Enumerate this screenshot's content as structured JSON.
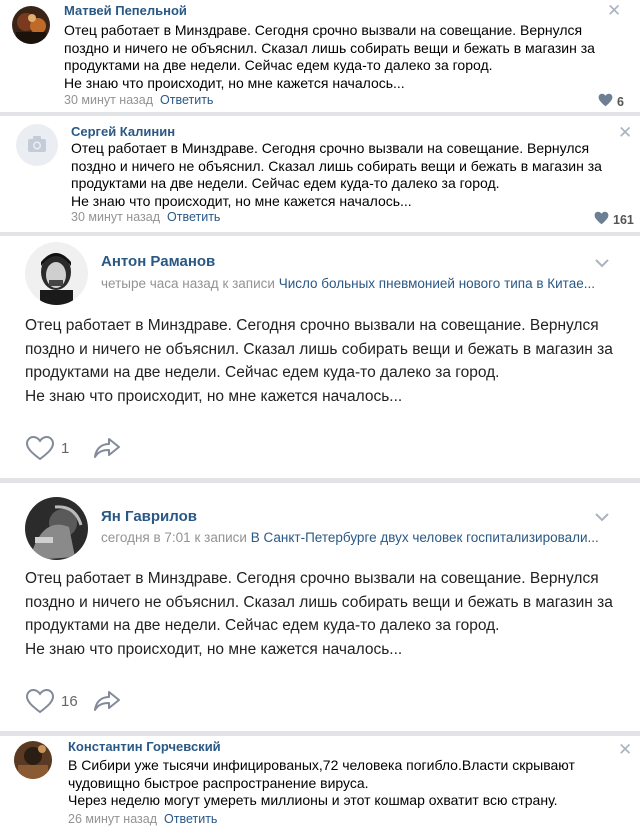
{
  "comments": [
    {
      "author": "Матвей Пепельной",
      "lines": [
        "Отец работает в Минздраве. Сегодня срочно вызвали на совещание. Вернулся",
        "поздно и ничего не объяснил. Сказал лишь собирать вещи и бежать в магазин за",
        "продуктами на две недели. Сейчас едем куда-то далеко за город.",
        "Не знаю что происходит, но мне кажется началось..."
      ],
      "time": "30 минут назад",
      "reply_label": "Ответить",
      "likes": "6",
      "close_glyph": "✕"
    },
    {
      "author": "Сергей Калинин",
      "lines": [
        "Отец работает в Минздраве. Сегодня срочно вызвали на совещание. Вернулся",
        "поздно и ничего не объяснил. Сказал лишь собирать вещи и бежать в магазин за",
        "продуктами на две недели. Сейчас едем куда-то далеко за город.",
        "Не знаю что происходит, но мне кажется началось..."
      ],
      "time": "30 минут назад",
      "reply_label": "Ответить",
      "likes": "161",
      "close_glyph": "✕"
    },
    {
      "author": "Константин Горчевский",
      "lines": [
        "В Сибири уже тысячи инфицированых,72 человека погибло.Власти скрывают",
        "чудовищно быстрое распространение вируса.",
        "Через неделю могут умереть миллионы и этот кошмар охватит всю страну."
      ],
      "time": "26 минут назад",
      "reply_label": "Ответить",
      "close_glyph": "✕"
    }
  ],
  "posts": [
    {
      "author": "Антон Раманов",
      "time": "четыре часа назад",
      "to_post": "к записи",
      "post_title": "Число больных пневмонией нового типа в Китае...",
      "lines": [
        "Отец работает в Минздраве. Сегодня срочно вызвали на совещание. Вернулся",
        "поздно и ничего не объяснил. Сказал лишь собирать вещи и бежать в магазин за",
        "продуктами на две недели. Сейчас едем куда-то далеко за город.",
        "Не знаю что происходит, но мне кажется началось..."
      ],
      "likes": "1"
    },
    {
      "author": "Ян Гаврилов",
      "time": "сегодня в 7:01",
      "to_post": "к записи",
      "post_title": "В Санкт-Петербурге двух человек госпитализировали...",
      "lines": [
        "Отец работает в Минздраве. Сегодня срочно вызвали на совещание. Вернулся",
        "поздно и ничего не объяснил. Сказал лишь собирать вещи и бежать в магазин за",
        "продуктами на две недели. Сейчас едем куда-то далеко за город.",
        "Не знаю что происходит, но мне кажется началось..."
      ],
      "likes": "16"
    }
  ],
  "colors": {
    "link": "#2a5885",
    "meta": "#939393",
    "background": "#edeef0",
    "card": "#ffffff",
    "icon": "#aab3c0"
  },
  "icons": {
    "like": "heart-icon",
    "share": "share-arrow-icon",
    "close": "close-icon",
    "menu": "chevron-down-icon",
    "placeholder_avatar": "camera-icon"
  }
}
